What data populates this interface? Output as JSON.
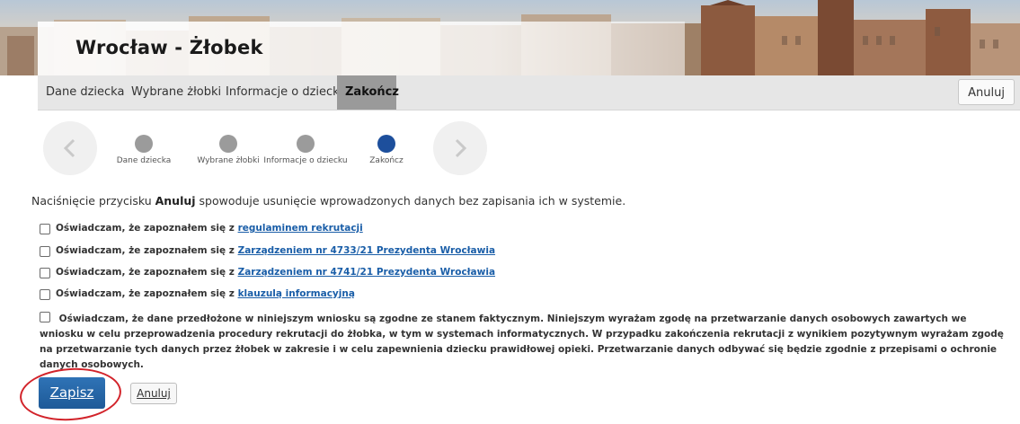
{
  "header": {
    "title": "Wrocław - Żłobek"
  },
  "tabs": [
    {
      "label": "Dane dziecka",
      "active": false
    },
    {
      "label": "Wybrane żłobki",
      "active": false
    },
    {
      "label": "Informacje o dziecku",
      "active": false
    },
    {
      "label": "Zakończ",
      "active": true
    }
  ],
  "top_cancel_label": "Anuluj",
  "stepper": {
    "prev_icon": "chevron-left-icon",
    "next_icon": "chevron-right-icon",
    "steps": [
      {
        "label": "Dane dziecka",
        "state": "done"
      },
      {
        "label": "Wybrane żłobki",
        "state": "done"
      },
      {
        "label": "Informacje o dziecku",
        "state": "done"
      },
      {
        "label": "Zakończ",
        "state": "current"
      }
    ]
  },
  "info": {
    "before": "Naciśnięcie przycisku ",
    "bold": "Anuluj",
    "after": " spowoduje usunięcie wprowadzonych danych bez zapisania ich w systemie."
  },
  "checkboxes": [
    {
      "prefix": "Oświadczam, że zapoznałem się z ",
      "link": "regulaminem rekrutacji",
      "checked": false
    },
    {
      "prefix": "Oświadczam, że zapoznałem się z ",
      "link": "Zarządzeniem nr 4733/21 Prezydenta Wrocławia",
      "checked": false
    },
    {
      "prefix": "Oświadczam, że zapoznałem się z ",
      "link": "Zarządzeniem nr 4741/21 Prezydenta Wrocławia",
      "checked": false
    },
    {
      "prefix": "Oświadczam, że zapoznałem się z ",
      "link": "klauzulą informacyjną",
      "checked": false
    }
  ],
  "declaration": {
    "text": "Oświadczam, że dane przedłożone w niniejszym wniosku są zgodne ze stanem faktycznym. Niniejszym wyrażam zgodę na przetwarzanie danych osobowych zawartych we wniosku w celu przeprowadzenia procedury rekrutacji do żłobka, w tym w systemach informatycznych. W przypadku zakończenia rekrutacji z wynikiem pozytywnym wyrażam zgodę na przetwarzanie tych danych przez żłobek w zakresie i w celu zapewnienia dziecku prawidłowej opieki. Przetwarzanie danych odbywać się będzie zgodnie z przepisami o ochronie danych osobowych.",
    "checked": false
  },
  "buttons": {
    "save": "Zapisz",
    "cancel": "Anuluj"
  },
  "colors": {
    "primary": "#1e5a98",
    "step_current": "#1d4f9c",
    "step_done": "#9b9b9b",
    "highlight": "#d2232a",
    "link": "#1a5ea8"
  }
}
